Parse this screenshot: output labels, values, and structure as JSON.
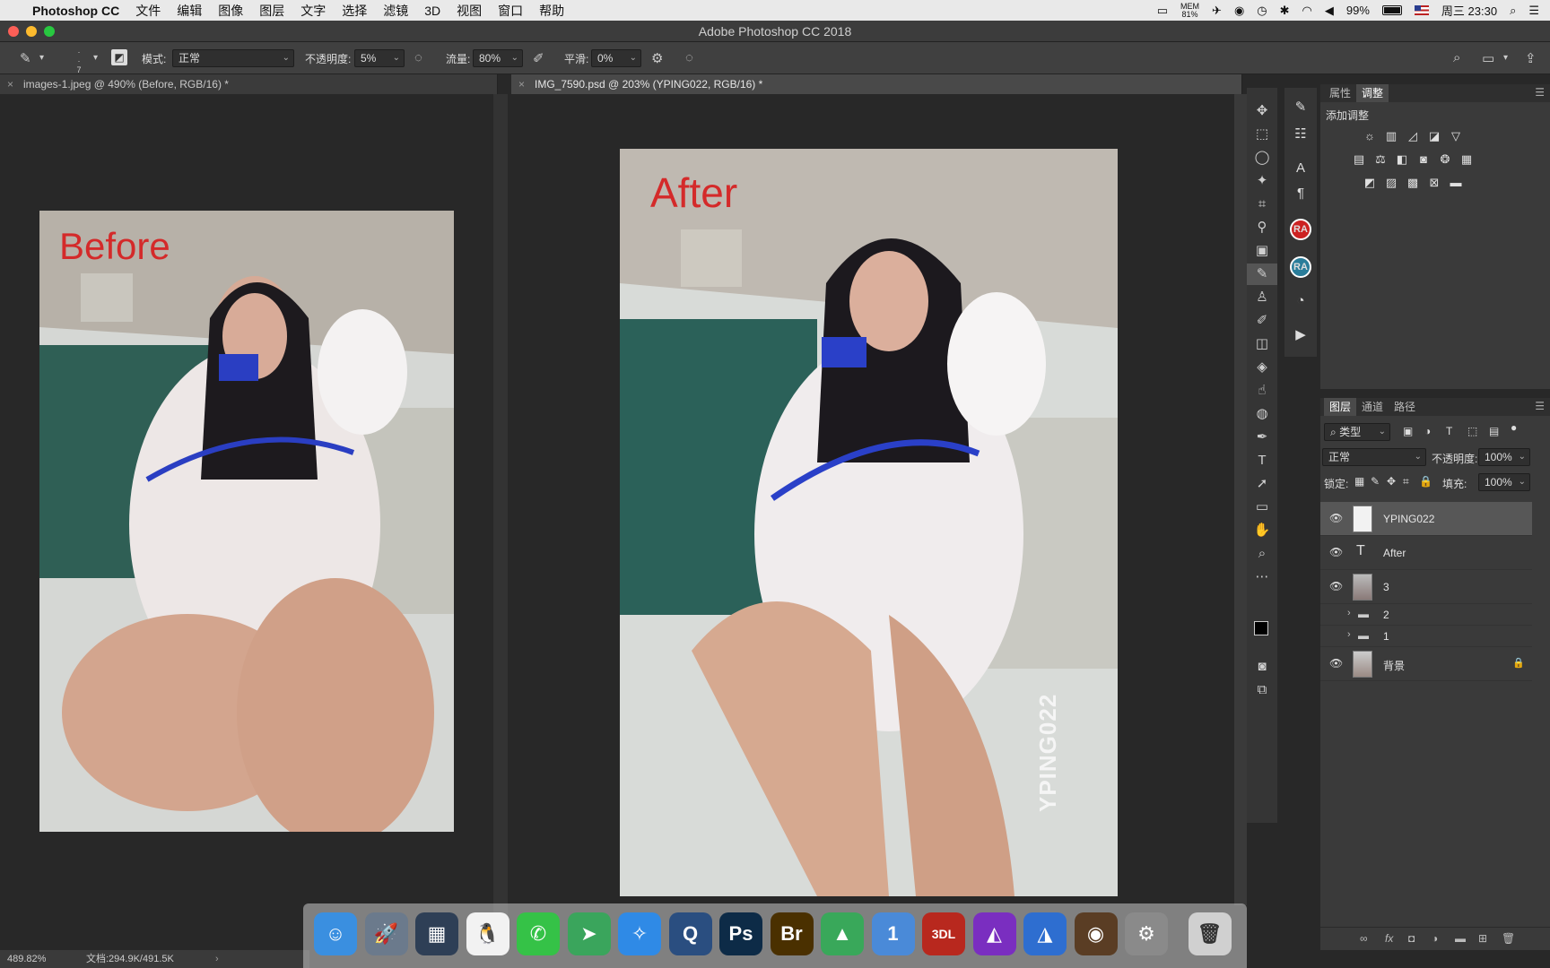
{
  "menubar": {
    "app_name": "Photoshop CC",
    "items": [
      "文件",
      "编辑",
      "图像",
      "图层",
      "文字",
      "选择",
      "滤镜",
      "3D",
      "视图",
      "窗口",
      "帮助"
    ],
    "mem_label": "MEM",
    "mem_value": "81%",
    "battery": "99%",
    "clock": "周三 23:30"
  },
  "window": {
    "title": "Adobe Photoshop CC 2018"
  },
  "options": {
    "brush_size": "7",
    "mode_label": "模式:",
    "mode_value": "正常",
    "opacity_label": "不透明度:",
    "opacity_value": "5%",
    "flow_label": "流量:",
    "flow_value": "80%",
    "smoothing_label": "平滑:",
    "smoothing_value": "0%"
  },
  "tabs": [
    {
      "label": "images-1.jpeg @ 490% (Before, RGB/16) *"
    },
    {
      "label": "IMG_7590.psd @ 203% (YPING022, RGB/16) *"
    }
  ],
  "canvas": {
    "before_text": "Before",
    "after_text": "After",
    "watermark": "YPING022"
  },
  "status": {
    "zoom": "489.82%",
    "doc": "文档:294.9K/491.5K"
  },
  "properties_panel": {
    "tabs": [
      "属性",
      "调整"
    ],
    "active_tab": "调整",
    "heading": "添加调整"
  },
  "layers_panel": {
    "tabs": [
      "图层",
      "通道",
      "路径"
    ],
    "active_tab": "图层",
    "filter_label": "类型",
    "blend_mode": "正常",
    "opacity_label": "不透明度:",
    "opacity_value": "100%",
    "lock_label": "锁定:",
    "fill_label": "填充:",
    "fill_value": "100%",
    "layers": [
      {
        "name": "YPING022",
        "kind": "pixel",
        "visible": true,
        "selected": true
      },
      {
        "name": "After",
        "kind": "text",
        "visible": true
      },
      {
        "name": "3",
        "kind": "pixel",
        "visible": true
      },
      {
        "name": "2",
        "kind": "group",
        "visible": false
      },
      {
        "name": "1",
        "kind": "group",
        "visible": false
      },
      {
        "name": "背景",
        "kind": "pixel",
        "visible": true,
        "locked": true
      }
    ]
  },
  "sidestrip": {
    "ra1": "RA",
    "ra2": "RA"
  },
  "dock": {
    "apps": [
      {
        "name": "Finder",
        "glyph": "☺",
        "color": "#3a8fe0"
      },
      {
        "name": "Launchpad",
        "glyph": "🚀",
        "color": "#6b7a8c"
      },
      {
        "name": "Photos Browser",
        "glyph": "▦",
        "color": "#2e3f56"
      },
      {
        "name": "QQ",
        "glyph": "🐧",
        "color": "#f2f2f2"
      },
      {
        "name": "WeChat",
        "glyph": "✆",
        "color": "#35c247"
      },
      {
        "name": "Telegram",
        "glyph": "➤",
        "color": "#3aa55c"
      },
      {
        "name": "Safari",
        "glyph": "✧",
        "color": "#2f8ae6"
      },
      {
        "name": "QuickTime",
        "glyph": "Q",
        "color": "#2a4e80"
      },
      {
        "name": "Photoshop",
        "glyph": "Ps",
        "color": "#0d2b47"
      },
      {
        "name": "Bridge",
        "glyph": "Br",
        "color": "#4a3000"
      },
      {
        "name": "Maps",
        "glyph": "▲",
        "color": "#39a85a"
      },
      {
        "name": "1Password",
        "glyph": "1",
        "color": "#4a8ad8"
      },
      {
        "name": "3DL",
        "glyph": "3DL",
        "color": "#b8281e"
      },
      {
        "name": "Affinity Photo",
        "glyph": "◭",
        "color": "#7a2ec0"
      },
      {
        "name": "Affinity Designer",
        "glyph": "◮",
        "color": "#2e6ed0"
      },
      {
        "name": "Music",
        "glyph": "◉",
        "color": "#5a3d24"
      },
      {
        "name": "System Preferences",
        "glyph": "⚙",
        "color": "#8a8a8a"
      },
      {
        "name": "Trash",
        "glyph": "🗑",
        "color": "#d0d0d0"
      }
    ]
  }
}
